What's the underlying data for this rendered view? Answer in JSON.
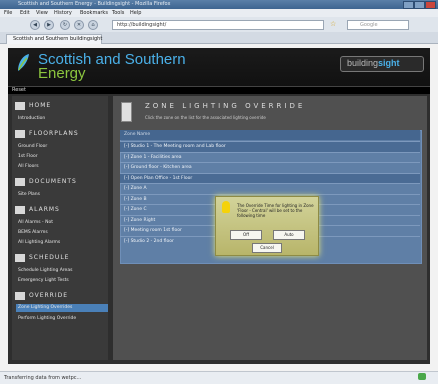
{
  "browser": {
    "title": "Scottish and Southern Energy - Buildingsight - Mozilla Firefox",
    "menu": [
      "File",
      "Edit",
      "View",
      "History",
      "Bookmarks",
      "Tools",
      "Help"
    ],
    "url": "http://buildingsight/",
    "search_placeholder": "Google",
    "tab_label": "Scottish and Southern buildingsight",
    "status_text": "Transferring data from wetpc..."
  },
  "header": {
    "brand_line1": "Scottish and Southern",
    "brand_line2": "Energy",
    "product_prefix": "building",
    "product_suffix": "sight",
    "crumb": "Reset"
  },
  "sidebar": {
    "sections": [
      {
        "label": "HOME",
        "items": [
          "Introduction"
        ]
      },
      {
        "label": "FLOORPLANS",
        "items": [
          "Ground Floor",
          "1st Floor",
          "All Floors"
        ]
      },
      {
        "label": "DOCUMENTS",
        "items": [
          "Site Plans"
        ]
      },
      {
        "label": "ALARMS",
        "items": [
          "All Alarms - Not",
          "BEMS Alarms",
          "All Lighting Alarms"
        ]
      },
      {
        "label": "SCHEDULE",
        "items": [
          "Schedule Lighting Areas",
          "Emergency Light Tests"
        ]
      },
      {
        "label": "OVERRIDE",
        "items": [
          "Zone Lighting Overrides",
          "Perform Lighting Override"
        ]
      }
    ],
    "active_item": "Zone Lighting Overrides"
  },
  "main": {
    "title": "ZONE LIGHTING OVERRIDE",
    "subtitle": "Click the zone on the list for the associated lighting override",
    "panel_header": "Zone Name",
    "rows": [
      {
        "label": "[-] Studio 1 - The Meeting room and Lab floor",
        "dark": true
      },
      {
        "label": "[-] Zone 1 - Facilities area",
        "dark": false
      },
      {
        "label": "[-] Ground floor - Kitchen area",
        "dark": false
      },
      {
        "label": "[-] Open Plan Office - 1st Floor",
        "dark": true
      },
      {
        "label": "[-] Zone A",
        "dark": false
      },
      {
        "label": "[-] Zone B",
        "dark": false
      },
      {
        "label": "[-] Zone C",
        "dark": false
      },
      {
        "label": "[-] Zone Right",
        "dark": false
      },
      {
        "label": "[-] Meeting room 1st floor",
        "dark": false
      },
      {
        "label": "[-] Studio 2 - 2nd floor",
        "dark": false
      }
    ]
  },
  "dialog": {
    "line1": "The Override Time for lighting in Zone",
    "line2": "'Floor - Central' will be set to the",
    "line3": "following time",
    "btn1": "Off",
    "btn2": "Auto",
    "btn3": "Cancel"
  }
}
